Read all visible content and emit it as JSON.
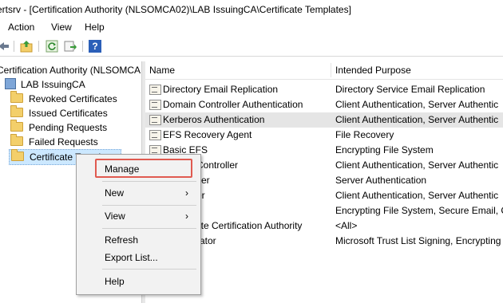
{
  "window": {
    "title": "ertsrv - [Certification Authority (NLSOMCA02)\\LAB IssuingCA\\Certificate Templates]"
  },
  "menu": [
    "Action",
    "View",
    "Help"
  ],
  "toolbar": {
    "icons": [
      "back-arrow-icon",
      "up-folder-icon",
      "refresh-icon",
      "export-list-icon",
      "help-icon"
    ],
    "help_glyph": "?"
  },
  "tree": {
    "root": "Certification Authority (NLSOMCA",
    "ca": "LAB IssuingCA",
    "folders": [
      "Revoked Certificates",
      "Issued Certificates",
      "Pending Requests",
      "Failed Requests",
      "Certificate Templates"
    ],
    "selected_index": 4
  },
  "list": {
    "columns": [
      "Name",
      "Intended Purpose"
    ],
    "rows": [
      {
        "name": "Directory Email Replication",
        "purpose": "Directory Service Email Replication"
      },
      {
        "name": "Domain Controller Authentication",
        "purpose": "Client Authentication, Server Authentic"
      },
      {
        "name": "Kerberos Authentication",
        "purpose": "Client Authentication, Server Authentic"
      },
      {
        "name": "EFS Recovery Agent",
        "purpose": "File Recovery"
      },
      {
        "name": "Basic EFS",
        "purpose": "Encrypting File System"
      },
      {
        "name": "Controller",
        "purpose": "Client Authentication, Server Authentic"
      },
      {
        "name": "ver",
        "purpose": "Server Authentication"
      },
      {
        "name": "er",
        "purpose": "Client Authentication, Server Authentic"
      },
      {
        "name": "",
        "purpose": "Encrypting File System, Secure Email, C"
      },
      {
        "name": "ate Certification Authority",
        "purpose": "<All>"
      },
      {
        "name": "rator",
        "purpose": "Microsoft Trust List Signing, Encrypting"
      }
    ],
    "selected_index": 2
  },
  "context_menu": {
    "items": [
      {
        "label": "Manage",
        "submenu": false
      },
      {
        "label": "New",
        "submenu": true
      },
      {
        "label": "View",
        "submenu": true
      },
      {
        "label": "Refresh",
        "submenu": false
      },
      {
        "label": "Export List...",
        "submenu": false
      },
      {
        "label": "Help",
        "submenu": false
      }
    ],
    "arrow_glyph": "›",
    "highlight_color": "#e05a50"
  }
}
